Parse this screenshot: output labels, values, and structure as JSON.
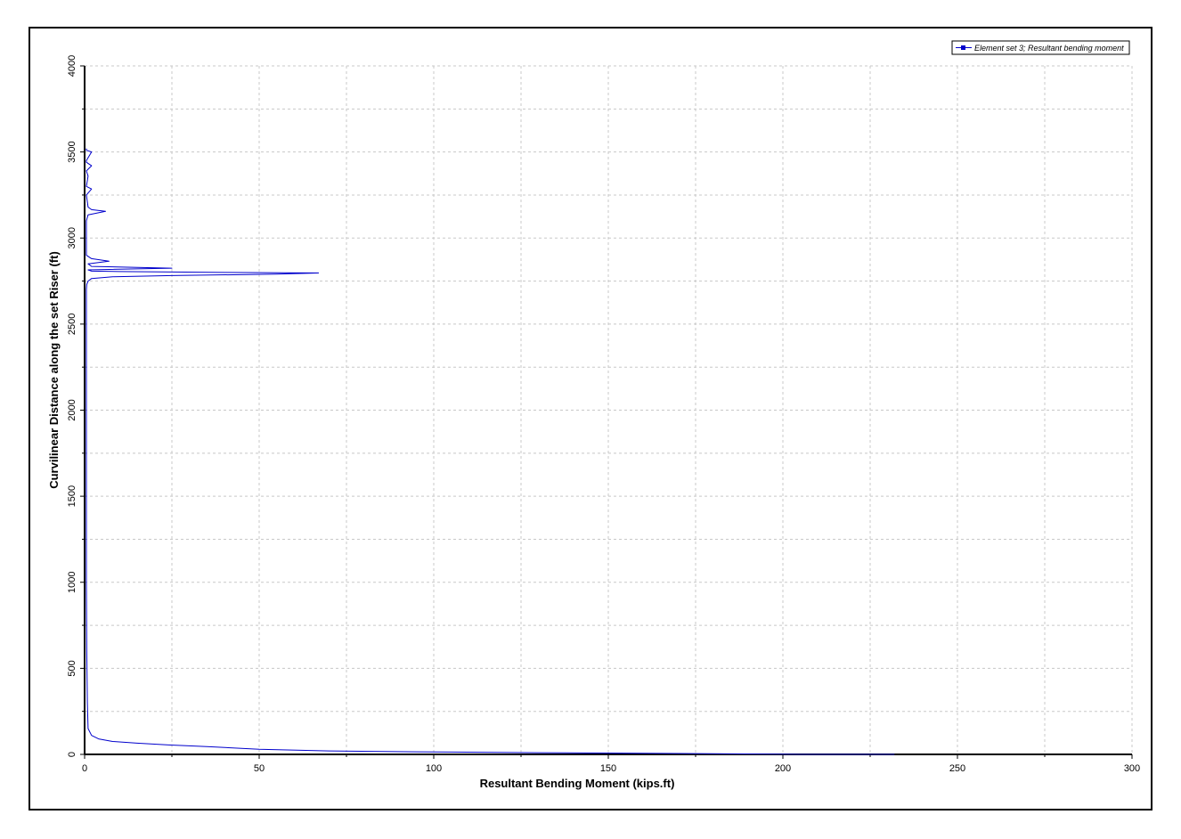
{
  "chart_data": {
    "type": "line",
    "title": "",
    "xlabel": "Resultant Bending Moment  (kips.ft)",
    "ylabel": "Curvilinear Distance along the set Riser (ft)",
    "xlim": [
      0,
      300
    ],
    "ylim": [
      0,
      4000
    ],
    "xticks": [
      "0",
      "50",
      "100",
      "150",
      "200",
      "250",
      "300"
    ],
    "yticks": [
      "0",
      "500",
      "1000",
      "1500",
      "2000",
      "2500",
      "3000",
      "3500",
      "4000"
    ],
    "grid": true,
    "legend_position": "top-right",
    "colors": {
      "series": "#0000cc",
      "grid": "#c8c8c8",
      "axis": "#000000"
    },
    "series": [
      {
        "name": "Element set  3; Resultant bending moment",
        "x": [
          232,
          205,
          170,
          130,
          95,
          70,
          50,
          35,
          24,
          15,
          8,
          4,
          2,
          1,
          0.8,
          0.6,
          0.5,
          0.5,
          0.5,
          0.5,
          0.5,
          0.5,
          0.6,
          1,
          2,
          8,
          25,
          55,
          67,
          40,
          10,
          2,
          1,
          25,
          2,
          1,
          7,
          2,
          0.5,
          0.5,
          1,
          6,
          2,
          1,
          0.5,
          2,
          0.5,
          1,
          0.5,
          2,
          0.5,
          0.5,
          2,
          0.5,
          0.5
        ],
        "y": [
          0,
          0,
          5,
          10,
          15,
          20,
          30,
          45,
          55,
          65,
          75,
          90,
          110,
          150,
          300,
          600,
          1000,
          1500,
          2000,
          2400,
          2600,
          2700,
          2730,
          2750,
          2765,
          2775,
          2782,
          2790,
          2797,
          2800,
          2805,
          2808,
          2815,
          2825,
          2835,
          2850,
          2865,
          2880,
          2900,
          3100,
          3135,
          3155,
          3165,
          3180,
          3250,
          3285,
          3300,
          3360,
          3390,
          3420,
          3440,
          3450,
          3500,
          3510,
          3520
        ]
      }
    ]
  }
}
